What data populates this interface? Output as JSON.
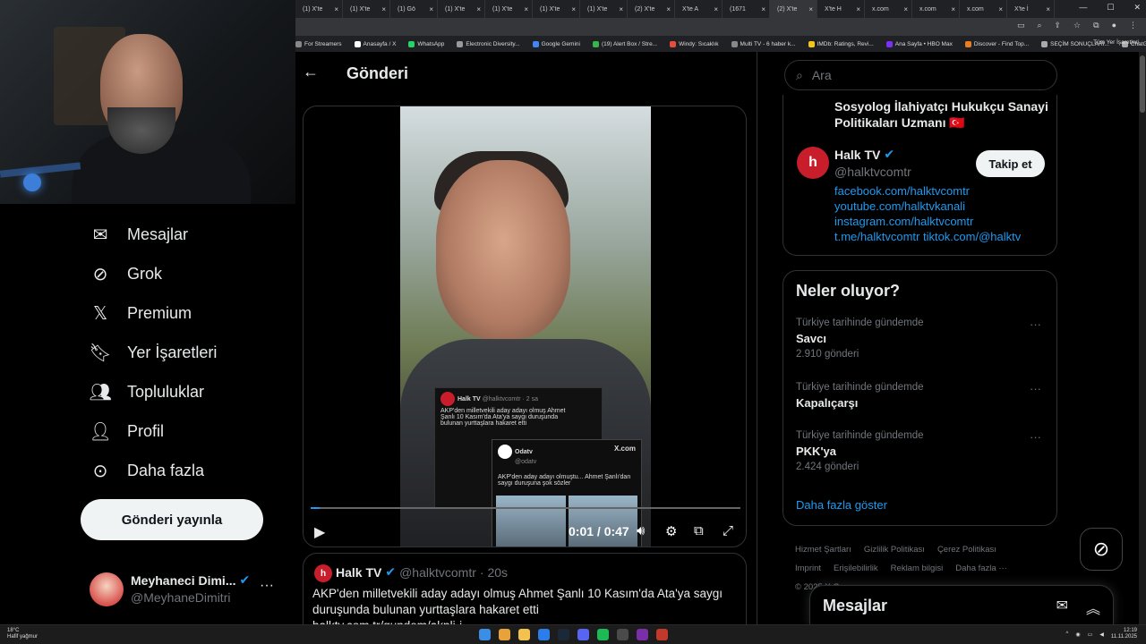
{
  "browser": {
    "tabs": [
      "(1) X'te",
      "(1) X'te",
      "(1) Gö",
      "(1) X'te",
      "(1) X'te",
      "(1) X'te",
      "(1) X'te",
      "(2) X'te",
      "X'te A",
      "(1671",
      "(2) X'te",
      "X'te H",
      "x.com",
      "x.com",
      "x.com",
      "X'te İ"
    ],
    "bookmarks": [
      "For Streamers",
      "Anasayfa / X",
      "WhatsApp",
      "Electronic Diversity...",
      "Google Gemini",
      "(19) Alert Box / Stre...",
      "Windy: Sıcaklık",
      "Multi TV - 6 haber k...",
      "IMDb: Ratings, Revi...",
      "Ana Sayfa • HBO Max",
      "Discover - Find Top...",
      "SEÇİM SONUÇLARI...",
      "ChatGPT"
    ],
    "all_bookmarks": "Tüm Yer İşaretleri"
  },
  "nav": {
    "items": [
      {
        "label": "Mesajlar",
        "icon": "mail-icon"
      },
      {
        "label": "Grok",
        "icon": "grok-icon"
      },
      {
        "label": "Premium",
        "icon": "x-logo-icon"
      },
      {
        "label": "Yer İşaretleri",
        "icon": "bookmark-icon"
      },
      {
        "label": "Topluluklar",
        "icon": "communities-icon"
      },
      {
        "label": "Profil",
        "icon": "profile-icon"
      },
      {
        "label": "Daha fazla",
        "icon": "more-circle-icon"
      }
    ],
    "post_button": "Gönderi yayınla",
    "account": {
      "name": "Meyhaneci Dimi...",
      "handle": "@MeyhaneDimitri"
    }
  },
  "main": {
    "title": "Gönderi",
    "video": {
      "time": "0:01 / 0:47",
      "progress": 0.02,
      "card1": {
        "name": "Halk TV",
        "handle": "@halktvcomtr · 2 sa",
        "text": "AKP'den milletvekili aday adayı olmuş Ahmet Şanlı 10 Kasım'da Ata'ya saygı duruşunda bulunan yurttaşlara hakaret etti"
      },
      "card2": {
        "name": "Odatv",
        "handle": "@odatv",
        "brand": "X.com",
        "text": "AKP'den aday adayı olmuştu... Ahmet Şanlı'dan saygı duruşuna şok sözler"
      }
    },
    "reply": {
      "avatar": "h",
      "name": "Halk TV",
      "handle": "@halktvcomtr",
      "time": "· 20s",
      "text": "AKP'den milletvekili aday adayı olmuş Ahmet Şanlı 10 Kasım'da Ata'ya saygı duruşunda bulunan yurttaşlara hakaret etti",
      "link": "halktv.com.tr/gundem/akpli-i..."
    }
  },
  "right": {
    "search_placeholder": "Ara",
    "bio_top": "Sosyolog İlahiyatçı Hukukçu Sanayi Politikaları Uzmanı 🇹🇷",
    "halk": {
      "avatar": "h",
      "name": "Halk TV",
      "handle": "@halktvcomtr",
      "follow": "Takip et",
      "links": [
        "facebook.com/halktvcomtr",
        "youtube.com/halktvkanali",
        "instagram.com/halktvcomtr",
        "t.me/halktvcomtr tiktok.com/@halktv"
      ]
    },
    "trends_title": "Neler oluyor?",
    "trends": [
      {
        "context": "Türkiye tarihinde gündemde",
        "name": "Savcı",
        "count": "2.910 gönderi"
      },
      {
        "context": "Türkiye tarihinde gündemde",
        "name": "Kapalıçarşı",
        "count": ""
      },
      {
        "context": "Türkiye tarihinde gündemde",
        "name": "PKK'ya",
        "count": "2.424 gönderi"
      }
    ],
    "show_more": "Daha fazla göster",
    "footer": [
      "Hizmet Şartları",
      "Gizlilik Politikası",
      "Çerez Politikası",
      "Imprint",
      "Erişilebilirlik",
      "Reklam bilgisi",
      "Daha fazla ···",
      "© 2025 X Corp."
    ],
    "messages_dock": "Mesajlar"
  },
  "taskbar": {
    "weather_temp": "18°C",
    "weather_desc": "Hafif yağmur",
    "time": "12:19",
    "date": "11.11.2025"
  },
  "colors": {
    "accent": "#1d9bf0",
    "bg": "#000000",
    "halk_red": "#c81e2b"
  }
}
